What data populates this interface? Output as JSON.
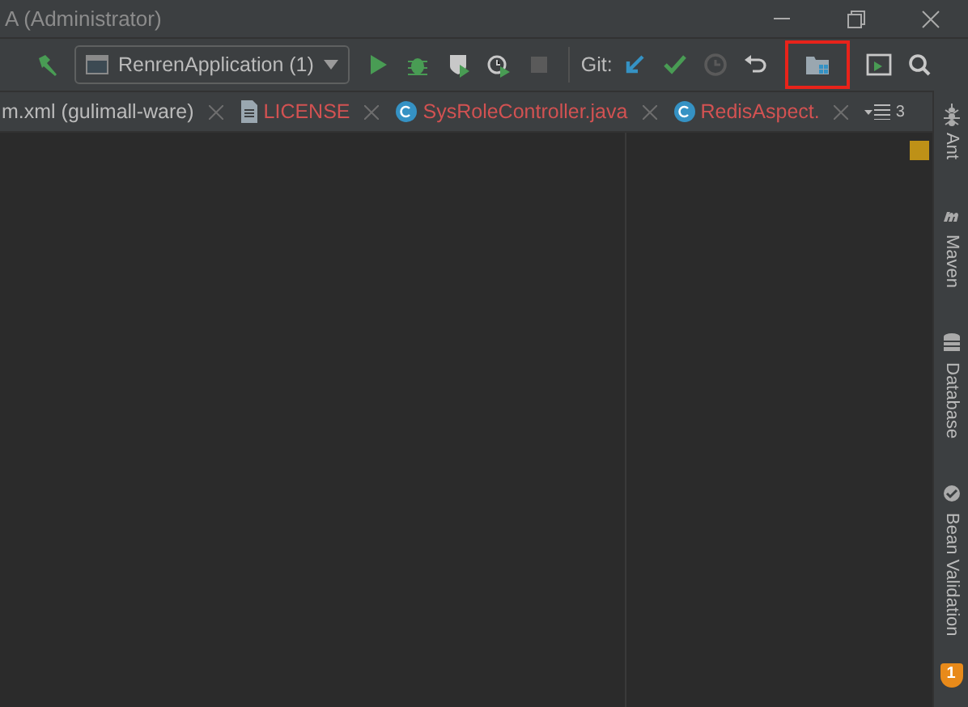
{
  "window": {
    "title": "A (Administrator)"
  },
  "toolbar": {
    "run_config": "RenrenApplication (1)",
    "git_label": "Git:",
    "stop_disabled": true,
    "history_disabled": true,
    "project_structure_highlighted": true
  },
  "tabs": [
    {
      "label": "m.xml (gulimall-ware)",
      "kind": "plain",
      "color": "#bbbbbb"
    },
    {
      "label": "LICENSE",
      "kind": "file",
      "color": "#d25252"
    },
    {
      "label": "SysRoleController.java",
      "kind": "class",
      "color": "#d25252"
    },
    {
      "label": "RedisAspect.",
      "kind": "class",
      "color": "#d25252"
    }
  ],
  "tab_overflow": "3",
  "sidebar": [
    {
      "label": "Ant"
    },
    {
      "label": "Maven"
    },
    {
      "label": "Database"
    },
    {
      "label": "Bean Validation"
    }
  ],
  "notifications": {
    "count": "1"
  }
}
